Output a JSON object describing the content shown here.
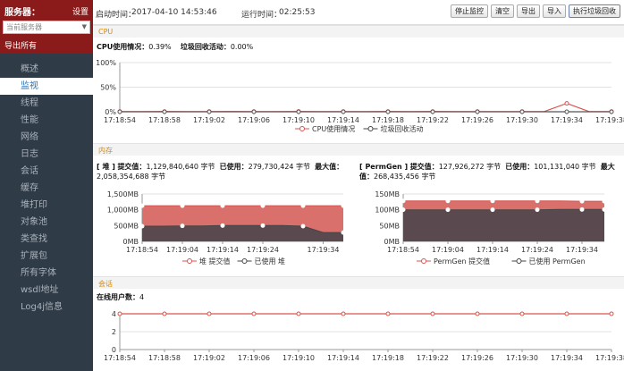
{
  "sidebar": {
    "title": "服务器：",
    "settings": "设置",
    "server_select": "当前服务器",
    "export_all": "导出所有",
    "nav": [
      "概述",
      "监视",
      "线程",
      "性能",
      "网络",
      "日志",
      "会话",
      "缓存",
      "堆打印",
      "对象池",
      "类查找",
      "扩展包",
      "所有字体",
      "wsdl地址",
      "Log4j信息"
    ],
    "active_index": 1
  },
  "topbar": {
    "start_label": "启动时间：",
    "start_value": "2017-04-10 14:53:46",
    "run_label": "运行时间：",
    "run_value": "02:25:53",
    "buttons": [
      "停止监控",
      "清空",
      "导出",
      "导入",
      "执行垃圾回收"
    ]
  },
  "cpu": {
    "title": "CPU",
    "usage_label": "CPU使用情况：",
    "usage_value": "0.39%",
    "gc_label": "垃圾回收活动：",
    "gc_value": "0.00%"
  },
  "memory": {
    "title": "内存",
    "heap": {
      "label": "[ 堆 ]",
      "committed_label": "提交值：",
      "committed_value": "1,129,840,640 字节",
      "used_label": "已使用：",
      "used_value": "279,730,424 字节",
      "max_label": "最大值：",
      "max_value": "2,058,354,688 字节"
    },
    "permgen": {
      "label": "[ PermGen ]",
      "committed_label": "提交值：",
      "committed_value": "127,926,272 字节",
      "used_label": "已使用：",
      "used_value": "101,131,040 字节",
      "max_label": "最大值：",
      "max_value": "268,435,456 字节"
    }
  },
  "session": {
    "title": "会话",
    "online_label": "在线用户数：",
    "online_value": "4"
  },
  "colors": {
    "sidebar_bg": "#2f3b47",
    "server_header": "#8b1a1a",
    "series_red": "#d9534f",
    "series_dark": "#555555",
    "section_title": "#d88b00",
    "area_fill_red": "#d9706b",
    "area_fill_dark": "#5a4a50"
  },
  "chart_data": [
    {
      "id": "cpu",
      "type": "line",
      "x": [
        "17:18:54",
        "17:18:56",
        "17:18:58",
        "17:19:00",
        "17:19:02",
        "17:19:04",
        "17:19:06",
        "17:19:08",
        "17:19:10",
        "17:19:12",
        "17:19:14",
        "17:19:16",
        "17:19:18",
        "17:19:20",
        "17:19:22",
        "17:19:24",
        "17:19:26",
        "17:19:28",
        "17:19:30",
        "17:19:32",
        "17:19:34",
        "17:19:36",
        "17:19:38"
      ],
      "x_ticks": [
        "17:18:54",
        "17:18:58",
        "17:19:02",
        "17:19:06",
        "17:19:10",
        "17:19:14",
        "17:19:18",
        "17:19:22",
        "17:19:26",
        "17:19:30",
        "17:19:34",
        "17:19:38"
      ],
      "y_ticks": [
        "0%",
        "50%",
        "100%"
      ],
      "ylim": [
        0,
        100
      ],
      "series": [
        {
          "name": "CPU使用情况",
          "color": "#d9534f",
          "values": [
            0.4,
            0.4,
            0.5,
            0.4,
            0.4,
            0.5,
            0.4,
            0.4,
            0.6,
            0.4,
            0.4,
            0.4,
            0.5,
            0.4,
            0.5,
            0.4,
            0.4,
            0.4,
            0.4,
            0.5,
            17,
            0.4,
            0.4
          ]
        },
        {
          "name": "垃圾回收活动",
          "color": "#555555",
          "values": [
            0,
            0,
            0,
            0,
            0,
            0,
            0,
            0,
            0,
            0,
            0,
            0,
            0,
            0,
            0,
            0,
            0,
            0,
            0,
            0,
            0,
            0,
            0
          ]
        }
      ],
      "legend_position": "bottom"
    },
    {
      "id": "heap",
      "type": "area",
      "x": [
        "17:18:54",
        "17:18:59",
        "17:19:04",
        "17:19:09",
        "17:19:14",
        "17:19:19",
        "17:19:24",
        "17:19:29",
        "17:19:32",
        "17:19:34",
        "17:19:39"
      ],
      "x_ticks": [
        "17:18:54",
        "17:19:04",
        "17:19:14",
        "17:19:24",
        "17:19:34"
      ],
      "y_ticks": [
        "0MB",
        "500MB",
        "1,000MB",
        "1,500MB"
      ],
      "ylim": [
        0,
        1500
      ],
      "series": [
        {
          "name": "堆 提交值",
          "color": "#d9534f",
          "values": [
            1130,
            1130,
            1130,
            1130,
            1130,
            1130,
            1130,
            1130,
            1130,
            1130,
            1130
          ]
        },
        {
          "name": "已使用 堆",
          "color": "#555555",
          "values": [
            480,
            480,
            490,
            490,
            500,
            500,
            500,
            500,
            480,
            280,
            280
          ]
        }
      ],
      "legend_position": "bottom"
    },
    {
      "id": "permgen",
      "type": "area",
      "x": [
        "17:18:54",
        "17:18:59",
        "17:19:04",
        "17:19:09",
        "17:19:14",
        "17:19:19",
        "17:19:24",
        "17:19:29",
        "17:19:34",
        "17:19:39"
      ],
      "x_ticks": [
        "17:18:54",
        "17:19:04",
        "17:19:14",
        "17:19:24",
        "17:19:34"
      ],
      "y_ticks": [
        "0MB",
        "50MB",
        "100MB",
        "150MB"
      ],
      "ylim": [
        0,
        150
      ],
      "series": [
        {
          "name": "PermGen 提交值",
          "color": "#d9534f",
          "values": [
            128,
            128,
            128,
            128,
            128,
            128,
            128,
            128,
            127,
            127
          ]
        },
        {
          "name": "已使用 PermGen",
          "color": "#555555",
          "values": [
            100,
            100,
            100,
            100,
            100,
            100,
            100,
            101,
            101,
            101
          ]
        }
      ],
      "legend_position": "bottom"
    },
    {
      "id": "session",
      "type": "line",
      "x": [
        "17:18:54",
        "17:18:56",
        "17:18:58",
        "17:19:00",
        "17:19:02",
        "17:19:04",
        "17:19:06",
        "17:19:08",
        "17:19:10",
        "17:19:12",
        "17:19:14",
        "17:19:16",
        "17:19:18",
        "17:19:20",
        "17:19:22",
        "17:19:24",
        "17:19:26",
        "17:19:28",
        "17:19:30",
        "17:19:32",
        "17:19:34",
        "17:19:36",
        "17:19:38"
      ],
      "x_ticks": [
        "17:18:54",
        "17:18:58",
        "17:19:02",
        "17:19:06",
        "17:19:10",
        "17:19:14",
        "17:19:18",
        "17:19:22",
        "17:19:26",
        "17:19:30",
        "17:19:34",
        "17:19:38"
      ],
      "y_ticks": [
        "0",
        "2",
        "4"
      ],
      "ylim": [
        0,
        4
      ],
      "series": [
        {
          "name": "",
          "color": "#d9534f",
          "values": [
            4,
            4,
            4,
            4,
            4,
            4,
            4,
            4,
            4,
            4,
            4,
            4,
            4,
            4,
            4,
            4,
            4,
            4,
            4,
            4,
            4,
            4,
            4
          ]
        }
      ]
    }
  ]
}
